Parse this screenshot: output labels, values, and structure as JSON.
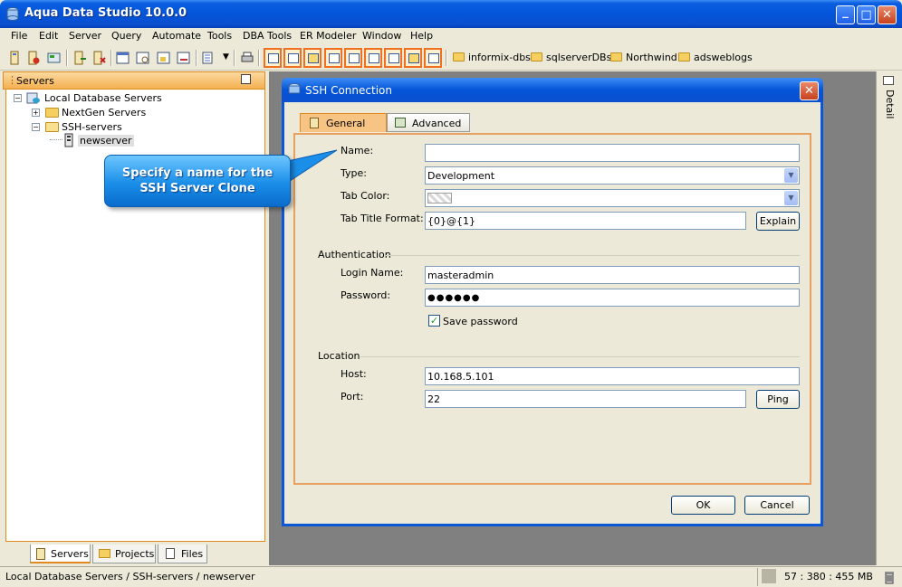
{
  "window": {
    "title": "Aqua Data Studio 10.0.0",
    "minimize_glyph": "_",
    "maximize_glyph": "□",
    "close_glyph": "✕"
  },
  "menu": [
    "File",
    "Edit",
    "Server",
    "Query",
    "Automate",
    "Tools",
    "DBA Tools",
    "ER Modeler",
    "Window",
    "Help"
  ],
  "bookmarks": [
    "informix-dbs",
    "sqlserverDBs",
    "Northwind",
    "adsweblogs"
  ],
  "left_panel": {
    "header": "Servers",
    "tree": [
      {
        "label": "Local Database Servers",
        "expander": "−"
      },
      {
        "label": "NextGen Servers",
        "expander": "+"
      },
      {
        "label": "SSH-servers",
        "expander": "−"
      },
      {
        "label": "newserver",
        "expander": ""
      }
    ],
    "tabs": [
      "Servers",
      "Projects",
      "Files"
    ]
  },
  "detail_strip": {
    "label": "Detail"
  },
  "callout": {
    "line1": "Specify a name for the",
    "line2": "SSH Server Clone"
  },
  "dialog": {
    "title": "SSH Connection",
    "tabs": [
      "General",
      "Advanced"
    ],
    "fields": {
      "name_label": "Name:",
      "name_value": "",
      "type_label": "Type:",
      "type_value": "Development",
      "tab_color_label": "Tab Color:",
      "tab_title_format_label": "Tab Title Format:",
      "tab_title_format_value": "{0}@{1}",
      "explain_button": "Explain",
      "authentication_group": "Authentication",
      "login_name_label": "Login Name:",
      "login_name_value": "masteradmin",
      "password_label": "Password:",
      "password_value": "●●●●●●",
      "save_password_label": "Save password",
      "save_password_checked": true,
      "location_group": "Location",
      "host_label": "Host:",
      "host_value": "10.168.5.101",
      "port_label": "Port:",
      "port_value": "22",
      "ping_button": "Ping"
    },
    "ok_button": "OK",
    "cancel_button": "Cancel"
  },
  "status": {
    "path": "Local Database Servers / SSH-servers / newserver",
    "memory": "57 : 380 : 455 MB"
  },
  "colors": {
    "title_blue": "#0454d8",
    "accent_orange": "#e08a20",
    "workspace_gray": "#808080",
    "callout_blue": "#1a8ee8"
  }
}
